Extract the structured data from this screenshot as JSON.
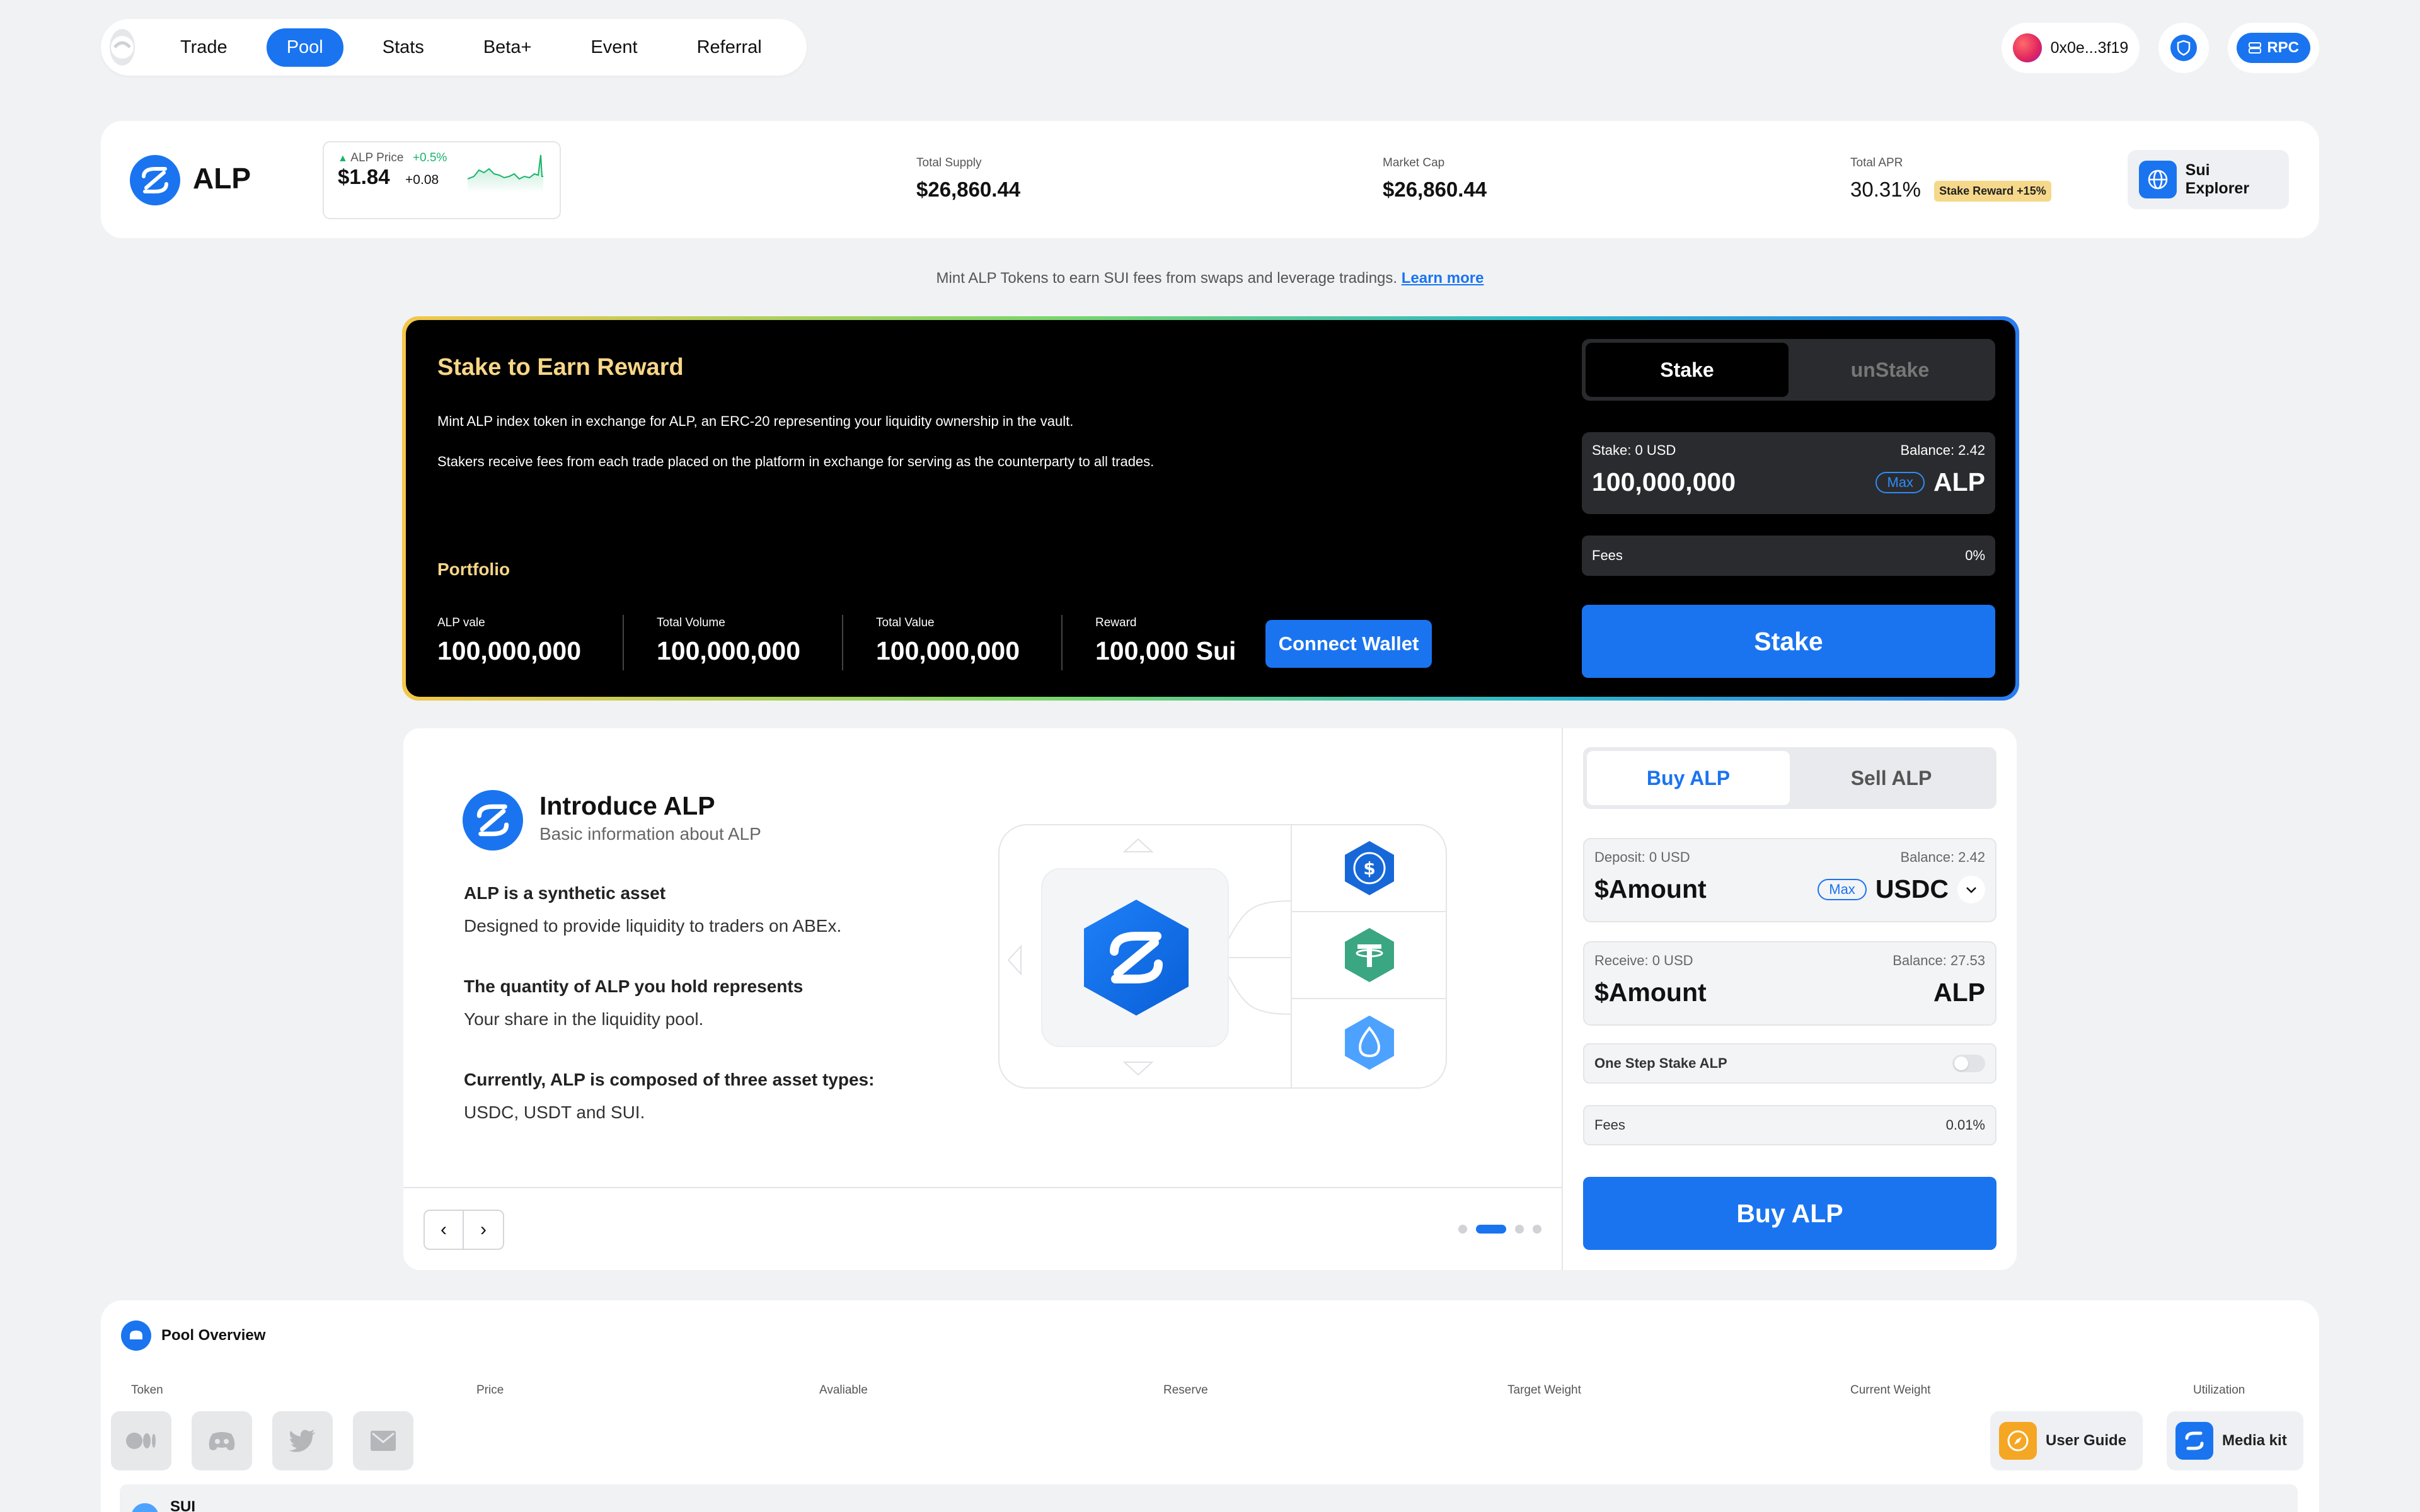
{
  "nav": {
    "items": [
      "Trade",
      "Pool",
      "Stats",
      "Beta+",
      "Event",
      "Referral"
    ],
    "active": "Pool"
  },
  "wallet": {
    "address": "0x0e...3f19",
    "rpc_label": "RPC"
  },
  "header": {
    "token": "ALP",
    "price_label": "ALP Price",
    "price_change_pct": "+0.5%",
    "price": "$1.84",
    "price_delta": "+0.08",
    "total_supply_label": "Total Supply",
    "total_supply": "$26,860.44",
    "market_cap_label": "Market Cap",
    "market_cap": "$26,860.44",
    "apr_label": "Total APR",
    "apr": "30.31%",
    "stake_reward": "Stake Reward +15%",
    "explorer_label": "Sui Explorer"
  },
  "mint_info": {
    "text": "Mint ALP Tokens to earn SUI fees from swaps and leverage tradings.",
    "link": "Learn more"
  },
  "stake_panel": {
    "title": "Stake to Earn Reward",
    "desc1": "Mint ALP index token in exchange for ALP, an ERC-20 representing your liquidity ownership in the vault.",
    "desc2": "Stakers receive fees from each trade placed on the platform in exchange for serving as the counterparty to all trades.",
    "portfolio_label": "Portfolio",
    "stats": [
      {
        "label": "ALP vale",
        "value": "100,000,000"
      },
      {
        "label": "Total Volume",
        "value": "100,000,000"
      },
      {
        "label": "Total Value",
        "value": "100,000,000"
      },
      {
        "label": "Reward",
        "value": "100,000 Sui"
      }
    ],
    "connect_label": "Connect Wallet",
    "tabs": [
      "Stake",
      "unStake"
    ],
    "input_top_left": "Stake: 0 USD",
    "input_top_right": "Balance: 2.42",
    "input_amount": "100,000,000",
    "max_label": "Max",
    "input_token": "ALP",
    "fees_label": "Fees",
    "fees_value": "0%",
    "action_label": "Stake"
  },
  "intro": {
    "title": "Introduce ALP",
    "subtitle": "Basic information about ALP",
    "q1": "ALP is a synthetic asset",
    "a1": "Designed to provide liquidity to traders on ABEx.",
    "q2": "The quantity of ALP you hold represents",
    "a2": "Your share in the liquidity pool.",
    "q3": "Currently, ALP is composed of three asset types:",
    "a3": "USDC, USDT and SUI.",
    "assets": [
      "usdc-icon",
      "usdt-icon",
      "sui-icon"
    ],
    "carousel_active_index": 1,
    "carousel_count": 4
  },
  "buy_panel": {
    "tabs": [
      "Buy ALP",
      "Sell ALP"
    ],
    "deposit_label": "Deposit: 0 USD",
    "deposit_balance": "Balance: 2.42",
    "deposit_placeholder": "$Amount",
    "max_label": "Max",
    "deposit_token": "USDC",
    "receive_label": "Receive: 0 USD",
    "receive_balance": "Balance: 27.53",
    "receive_placeholder": "$Amount",
    "receive_token": "ALP",
    "one_step_label": "One Step Stake ALP",
    "fees_label": "Fees",
    "fees_value": "0.01%",
    "action_label": "Buy ALP"
  },
  "pool_overview": {
    "title": "Pool Overview",
    "columns": [
      "Token",
      "Price",
      "Avaliable",
      "Reserve",
      "Target Weight",
      "Current Weight",
      "Utilization"
    ],
    "first_row_token": "SUI"
  },
  "footer": {
    "user_guide": "User Guide",
    "media_kit": "Media kit",
    "social": [
      "medium-icon",
      "discord-icon",
      "twitter-icon",
      "mail-icon"
    ]
  },
  "colors": {
    "accent": "#1a74f0",
    "gold": "#f7d687",
    "green": "#19b46a"
  }
}
